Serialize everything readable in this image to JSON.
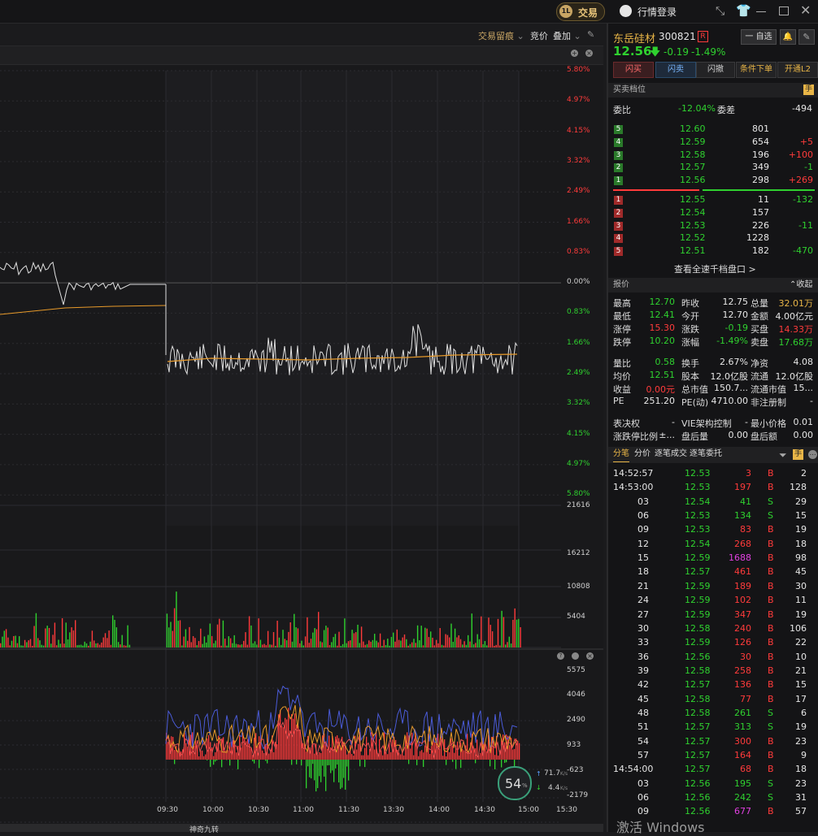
{
  "topbar": {
    "trade_label": "交易",
    "login_label": "行情登录"
  },
  "toolbar": {
    "trace_label": "交易留痕",
    "auction_label": "竞价",
    "overlay_label": "叠加"
  },
  "price_axis": [
    "5.80%",
    "4.97%",
    "4.15%",
    "3.32%",
    "2.49%",
    "1.66%",
    "0.83%",
    "0.00%",
    "0.83%",
    "1.66%",
    "2.49%",
    "3.32%",
    "4.15%",
    "4.97%",
    "5.80%"
  ],
  "volume_axis": [
    "21616",
    "16212",
    "10808",
    "5404"
  ],
  "indicator_axis": [
    "5575",
    "4046",
    "2490",
    "933",
    "-623",
    "-2179"
  ],
  "time_axis": [
    "09:30",
    "10:00",
    "10:30",
    "11:00",
    "11:30",
    "13:30",
    "14:00",
    "14:30",
    "15:00",
    "15:30"
  ],
  "colors": {
    "up": "#ff3b3b",
    "down": "#2fd12f",
    "gold": "#e8b547",
    "accent": "#c8a564"
  },
  "net": {
    "percent": "54",
    "unit": "%",
    "up_speed": "71.7",
    "down_speed": "4.4",
    "speed_unit": "K/s"
  },
  "stock": {
    "name": "东岳硅材",
    "code": "300821",
    "r_badge": "R",
    "fav_label": "一 自选",
    "price": "12.56",
    "change": "-0.19",
    "change_pct": "-1.49%"
  },
  "actions": [
    "闪买",
    "闪卖",
    "闪撤",
    "条件下单",
    "开通L2"
  ],
  "orderbook": {
    "title": "买卖档位",
    "unit_label": "手",
    "ratio_label": "委比",
    "ratio_value": "-12.04%",
    "diff_label": "委差",
    "diff_value": "-494",
    "asks": [
      {
        "lvl": "5",
        "price": "12.60",
        "vol": "801",
        "chg": ""
      },
      {
        "lvl": "4",
        "price": "12.59",
        "vol": "654",
        "chg": "+5"
      },
      {
        "lvl": "3",
        "price": "12.58",
        "vol": "196",
        "chg": "+100"
      },
      {
        "lvl": "2",
        "price": "12.57",
        "vol": "349",
        "chg": "-1"
      },
      {
        "lvl": "1",
        "price": "12.56",
        "vol": "298",
        "chg": "+269"
      }
    ],
    "bids": [
      {
        "lvl": "1",
        "price": "12.55",
        "vol": "11",
        "chg": "-132"
      },
      {
        "lvl": "2",
        "price": "12.54",
        "vol": "157",
        "chg": ""
      },
      {
        "lvl": "3",
        "price": "12.53",
        "vol": "226",
        "chg": "-11"
      },
      {
        "lvl": "4",
        "price": "12.52",
        "vol": "1228",
        "chg": ""
      },
      {
        "lvl": "5",
        "price": "12.51",
        "vol": "182",
        "chg": "-470"
      }
    ],
    "more_link": "查看全速千档盘口 >"
  },
  "quote": {
    "title": "报价",
    "collapse_label": "收起",
    "rows": [
      [
        "最高",
        "12.70",
        "昨收",
        "12.75",
        "总量",
        "32.01万"
      ],
      [
        "最低",
        "12.41",
        "今开",
        "12.70",
        "金额",
        "4.00亿元"
      ],
      [
        "涨停",
        "15.30",
        "涨跌",
        "-0.19",
        "买盘",
        "14.33万"
      ],
      [
        "跌停",
        "10.20",
        "涨幅",
        "-1.49%",
        "卖盘",
        "17.68万"
      ],
      [
        "量比",
        "0.58",
        "换手",
        "2.67%",
        "净资",
        "4.08"
      ],
      [
        "均价",
        "12.51",
        "股本",
        "12.0亿股",
        "流通",
        "12.0亿股"
      ],
      [
        "收益",
        "0.00元",
        "总市值",
        "150.7...",
        "流通市值",
        "15..."
      ],
      [
        "PE",
        "251.20",
        "PE(动)",
        "4710.00",
        "非注册制",
        "-"
      ],
      [
        "表决权",
        "-",
        "VIE架构控制",
        "-",
        "最小价格",
        "0.01"
      ],
      [
        "涨跌停比例",
        "±...",
        "盘后量",
        "0.00",
        "盘后额",
        "0.00"
      ]
    ]
  },
  "ticks": {
    "tabs": [
      "分笔",
      "分价",
      "逐笔成交",
      "逐笔委托"
    ],
    "unit_label": "手",
    "rows": [
      [
        "14:52:57",
        "12.53",
        "3",
        "B",
        "2"
      ],
      [
        "14:53:00",
        "12.53",
        "197",
        "B",
        "128"
      ],
      [
        "03",
        "12.54",
        "41",
        "S",
        "29"
      ],
      [
        "06",
        "12.53",
        "134",
        "S",
        "15"
      ],
      [
        "09",
        "12.53",
        "83",
        "B",
        "19"
      ],
      [
        "12",
        "12.54",
        "268",
        "B",
        "18"
      ],
      [
        "15",
        "12.59",
        "1688",
        "B",
        "98"
      ],
      [
        "18",
        "12.57",
        "461",
        "B",
        "45"
      ],
      [
        "21",
        "12.59",
        "189",
        "B",
        "30"
      ],
      [
        "24",
        "12.59",
        "102",
        "B",
        "11"
      ],
      [
        "27",
        "12.59",
        "347",
        "B",
        "19"
      ],
      [
        "30",
        "12.58",
        "240",
        "B",
        "106"
      ],
      [
        "33",
        "12.59",
        "126",
        "B",
        "22"
      ],
      [
        "36",
        "12.56",
        "30",
        "B",
        "10"
      ],
      [
        "39",
        "12.58",
        "258",
        "B",
        "21"
      ],
      [
        "42",
        "12.57",
        "136",
        "B",
        "15"
      ],
      [
        "45",
        "12.58",
        "77",
        "B",
        "17"
      ],
      [
        "48",
        "12.58",
        "261",
        "S",
        "6"
      ],
      [
        "51",
        "12.57",
        "313",
        "S",
        "19"
      ],
      [
        "54",
        "12.57",
        "300",
        "B",
        "23"
      ],
      [
        "57",
        "12.57",
        "164",
        "B",
        "9"
      ],
      [
        "14:54:00",
        "12.57",
        "68",
        "B",
        "18"
      ],
      [
        "03",
        "12.56",
        "195",
        "S",
        "23"
      ],
      [
        "06",
        "12.56",
        "242",
        "S",
        "31"
      ],
      [
        "09",
        "12.56",
        "677",
        "B",
        "57"
      ]
    ]
  },
  "watermark": "激活 Windows",
  "bottom_label": "神奇九转"
}
